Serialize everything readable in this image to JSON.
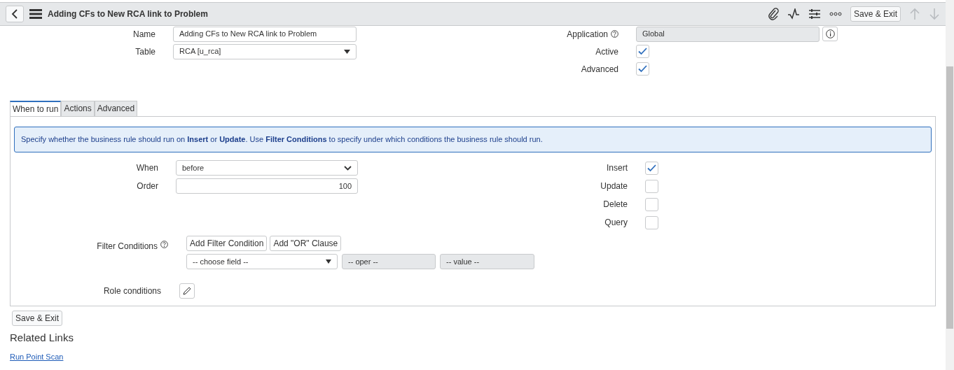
{
  "header": {
    "title": "Adding CFs to New RCA link to Problem",
    "save_button": "Save & Exit"
  },
  "top_left": [
    {
      "label": "Name",
      "value": "Adding CFs to New RCA link to Problem",
      "kind": "text"
    },
    {
      "label": "Table",
      "value": "RCA [u_rca]",
      "kind": "select"
    }
  ],
  "top_right": [
    {
      "label": "Application",
      "value": "Global",
      "kind": "readonly"
    },
    {
      "label": "Active",
      "checked": true,
      "kind": "checkbox"
    },
    {
      "label": "Advanced",
      "checked": true,
      "kind": "checkbox"
    }
  ],
  "tabs": [
    {
      "label": "When to run",
      "selected": true
    },
    {
      "label": "Actions",
      "selected": false
    },
    {
      "label": "Advanced",
      "selected": false
    }
  ],
  "info": "Specify whether the business rule should run on **Insert** or **Update**. Use **Filter Conditions** to specify under which conditions the business rule should run.",
  "when_fields": [
    {
      "label": "When",
      "value": "before",
      "kind": "select"
    },
    {
      "label": "Order",
      "value": "100",
      "kind": "number"
    }
  ],
  "operations": [
    {
      "label": "Insert",
      "checked": true
    },
    {
      "label": "Update",
      "checked": false
    },
    {
      "label": "Delete",
      "checked": false
    },
    {
      "label": "Query",
      "checked": false
    }
  ],
  "filter": {
    "label": "Filter Conditions",
    "buttons": [
      "Add Filter Condition",
      "Add \"OR\" Clause"
    ],
    "field": "-- choose field --",
    "oper": "-- oper --",
    "value": "-- value --"
  },
  "role_conditions": {
    "label": "Role conditions"
  },
  "save_button": "Save & Exit",
  "related_links": {
    "heading": "Related Links",
    "links": [
      "Run Point Scan"
    ]
  }
}
